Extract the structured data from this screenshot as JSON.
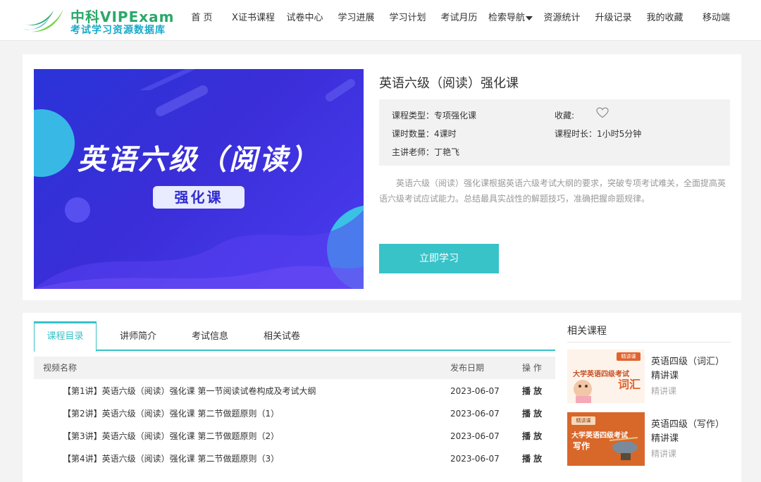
{
  "logo": {
    "title": "中科VIPExam",
    "subtitle": "考试学习资源数据库"
  },
  "nav": [
    "首 页",
    "X证书课程",
    "试卷中心",
    "学习进展",
    "学习计划",
    "考试月历",
    "检索导航",
    "资源统计",
    "升级记录",
    "我的收藏",
    "移动端"
  ],
  "banner": {
    "title": "英语六级（阅读）",
    "tag": "强化课"
  },
  "course": {
    "title": "英语六级（阅读）强化课",
    "type_label": "课程类型：",
    "type_value": "专项强化课",
    "hours_label": "课时数量：",
    "hours_value": "4课时",
    "teacher_label": "主讲老师：",
    "teacher_value": "丁艳飞",
    "fav_label": "收藏:",
    "duration_label": "课程时长：",
    "duration_value": "1小时5分钟",
    "description": "英语六级（阅读）强化课根据英语六级考试大纲的要求，突破专项考试难关，全面提高英语六级考试应试能力。总结最具实战性的解题技巧，准确把握命题规律。",
    "study_button": "立即学习"
  },
  "tabs": [
    "课程目录",
    "讲师简介",
    "考试信息",
    "相关试卷"
  ],
  "table": {
    "headers": [
      "视频名称",
      "发布日期",
      "操 作"
    ],
    "rows": [
      {
        "name": "【第1讲】英语六级（阅读）强化课 第一节阅读试卷构成及考试大纲",
        "date": "2023-06-07",
        "action": "播 放"
      },
      {
        "name": "【第2讲】英语六级（阅读）强化课 第二节做题原则（1）",
        "date": "2023-06-07",
        "action": "播 放"
      },
      {
        "name": "【第3讲】英语六级（阅读）强化课 第二节做题原则（2）",
        "date": "2023-06-07",
        "action": "播 放"
      },
      {
        "name": "【第4讲】英语六级（阅读）强化课 第二节做题原则（3）",
        "date": "2023-06-07",
        "action": "播 放"
      }
    ]
  },
  "related": {
    "title": "相关课程",
    "items": [
      {
        "name": "英语四级（词汇）精讲课",
        "sub": "精讲课",
        "thumb_tag": "精讲课",
        "thumb_title": "大学英语四级考试",
        "thumb_word": "词汇"
      },
      {
        "name": "英语四级（写作）精讲课",
        "sub": "精讲课",
        "thumb_tag": "精讲课",
        "thumb_title": "大学英语四级考试",
        "thumb_word": "写作"
      }
    ]
  },
  "colors": {
    "accent": "#37c3c8",
    "banner_blue": "#3a2ed8",
    "logo_green": "#2aa86a",
    "logo_blue": "#19a9c9"
  }
}
